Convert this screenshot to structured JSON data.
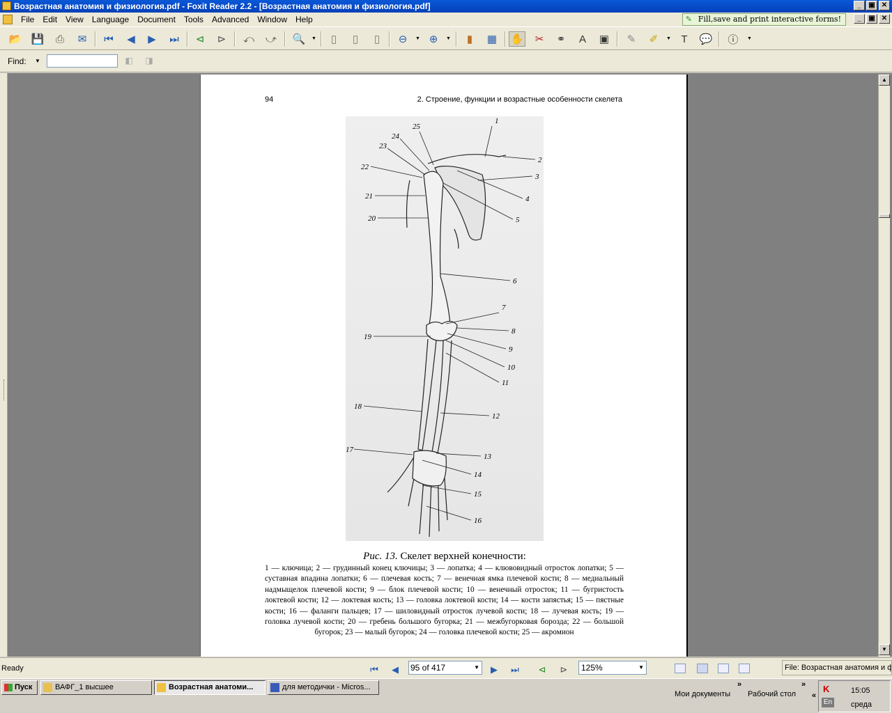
{
  "window": {
    "title": "Возрастная анатомия и физиология.pdf - Foxit Reader 2.2 - [Возрастная анатомия и физиология.pdf]",
    "minimize": "_",
    "maximize": "▣",
    "close": "✕"
  },
  "menu": {
    "items": [
      "File",
      "Edit",
      "View",
      "Language",
      "Document",
      "Tools",
      "Advanced",
      "Window",
      "Help"
    ],
    "fill_forms_label": "Fill,save and print interactive forms!"
  },
  "find": {
    "label": "Find:",
    "value": ""
  },
  "page": {
    "page_number": "94",
    "running_head": "2. Строение, функции и возрастные особенности скелета",
    "figure_labels": [
      "1",
      "2",
      "3",
      "4",
      "5",
      "6",
      "7",
      "8",
      "9",
      "10",
      "11",
      "12",
      "13",
      "14",
      "15",
      "16",
      "17",
      "18",
      "19",
      "20",
      "21",
      "22",
      "23",
      "24",
      "25"
    ],
    "caption_prefix": "Рис. 13.",
    "caption_title": " Скелет верхней конечности:",
    "caption_body": "1 — ключица; 2 — грудинный конец ключицы; 3 — лопатка; 4 — клювовидный отросток лопатки; 5 — суставная впадина лопатки; 6 — плечевая кость; 7 — венечная ямка плечевой кости; 8 — медиальный надмыщелок плечевой кости; 9 — блок плечевой кости; 10 — венечный отросток; 11 — бугристость локтевой кости; 12 — локтевая кость; 13 — головка локтевой кости; 14 — кости запястья; 15 — пястные кости; 16 — фаланги пальцев; 17 — шиловидный отросток лучевой кости; 18 — лучевая кость; 19 — головка лучевой кости; 20 — гребень большого бугорка; 21 — межбугорковая борозда; 22 — большой бугорок; 23 — малый бугорок; 24 — головка плечевой кости; 25 — акромион"
  },
  "status": {
    "ready": "Ready",
    "page_field": "95 of 417",
    "zoom": "125%",
    "file_info": "File: Возрастная анатомия и физиология.pdf"
  },
  "taskbar": {
    "start": "Пуск",
    "tasks": [
      "ВАФГ_1 высшее",
      "Возрастная анатоми...",
      "для методички - Micros..."
    ],
    "quick_docs": "Мои документы",
    "quick_desktop": "Рабочий стол",
    "tray_lang": "En",
    "time": "15:05",
    "day": "среда"
  },
  "colors": {
    "title_bar": "#0a58d8",
    "ui_face": "#ece9d8",
    "viewer_bg": "#808080",
    "nav_accent": "#2a5fb0"
  }
}
